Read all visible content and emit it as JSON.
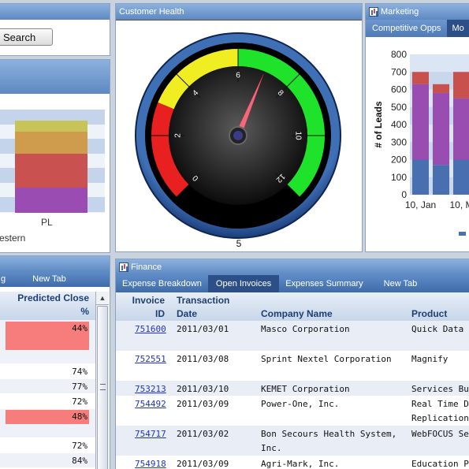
{
  "search_panel": {
    "search_label": "Search",
    "chart_title_bar": ""
  },
  "regional_panel": {
    "x_category": "PL",
    "footer_text": "estern"
  },
  "customer_health": {
    "title": "Customer Health",
    "gauge": {
      "min": 0,
      "max": 12,
      "value": 7,
      "readout": "5",
      "tick_labels": [
        "0",
        "2",
        "4",
        "6",
        "8",
        "10",
        "12"
      ],
      "bands": [
        {
          "from": 0,
          "to": 3,
          "color": "#e8201f"
        },
        {
          "from": 3,
          "to": 6,
          "color": "#f0ee22"
        },
        {
          "from": 6,
          "to": 12,
          "color": "#1fe22b"
        }
      ]
    }
  },
  "marketing": {
    "title": "Marketing",
    "tabs": [
      "Competitive Opps",
      "Mo"
    ],
    "active_tab": 1
  },
  "chart_data": {
    "type": "bar",
    "ylabel": "# of Leads",
    "ylim": [
      0,
      800
    ],
    "yticks": [
      0,
      100,
      200,
      300,
      400,
      500,
      600,
      700,
      800
    ],
    "categories": [
      "10, Jan",
      "",
      "10, M"
    ],
    "series": [
      {
        "values": [
          200,
          170,
          200
        ],
        "color": "#4a6fb0"
      },
      {
        "values": [
          430,
          410,
          350
        ],
        "color": "#9a4db0"
      },
      {
        "values": [
          70,
          50,
          150
        ],
        "color": "#c8504d"
      }
    ]
  },
  "left_panel": {
    "tabs": [
      "g",
      "New Tab"
    ],
    "header": {
      "predicted": "Predicted Close",
      "pct": "%"
    },
    "rows": [
      {
        "value": "44%",
        "highlight": true
      },
      {
        "value": "74%",
        "highlight": false
      },
      {
        "value": "77%",
        "highlight": false
      },
      {
        "value": "72%",
        "highlight": false
      },
      {
        "value": "48%",
        "highlight": true
      },
      {
        "value": "72%",
        "highlight": false
      },
      {
        "value": "84%",
        "highlight": false
      }
    ]
  },
  "finance": {
    "title": "Finance",
    "tabs": [
      "Expense Breakdown",
      "Open Invoices",
      "Expenses Summary",
      "New Tab"
    ],
    "active_tab": 1,
    "headers": {
      "invoice_1": "Invoice",
      "invoice_2": "ID",
      "date_1": "Transaction",
      "date_2": "Date",
      "company": "Company Name",
      "product": "Product"
    },
    "rows": [
      {
        "id": "751600",
        "date": "2011/03/01",
        "company": "Masco Corporation",
        "product": "Quick Data"
      },
      {
        "id": "752551",
        "date": "2011/03/08",
        "company": "Sprint Nextel Corporation",
        "product": "Magnify"
      },
      {
        "id": "753213",
        "date": "2011/03/10",
        "company": "KEMET Corporation",
        "product": "Services Bund"
      },
      {
        "id": "754492",
        "date": "2011/03/09",
        "company": "Power-One, Inc.",
        "product": "Real Time Dat Replication"
      },
      {
        "id": "754717",
        "date": "2011/03/02",
        "company": "Bon Secours Health System, Inc.",
        "product": "WebFOCUS Se"
      },
      {
        "id": "754918",
        "date": "2011/03/09",
        "company": "Agri-Mark, Inc.",
        "product": "Education Pa"
      }
    ]
  }
}
